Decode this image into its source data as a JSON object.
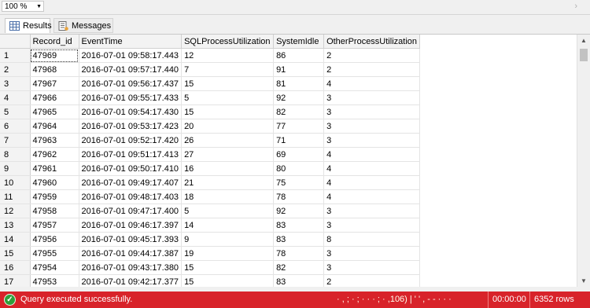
{
  "toolbar": {
    "zoom": "100 %"
  },
  "tabs": [
    {
      "label": "Results",
      "active": true
    },
    {
      "label": "Messages",
      "active": false
    }
  ],
  "grid": {
    "columns": [
      "",
      "Record_id",
      "EventTime",
      "SQLProcessUtilization",
      "SystemIdle",
      "OtherProcessUtilization"
    ],
    "rows": [
      [
        "1",
        "47969",
        "2016-07-01 09:58:17.443",
        "12",
        "86",
        "2"
      ],
      [
        "2",
        "47968",
        "2016-07-01 09:57:17.440",
        "7",
        "91",
        "2"
      ],
      [
        "3",
        "47967",
        "2016-07-01 09:56:17.437",
        "15",
        "81",
        "4"
      ],
      [
        "4",
        "47966",
        "2016-07-01 09:55:17.433",
        "5",
        "92",
        "3"
      ],
      [
        "5",
        "47965",
        "2016-07-01 09:54:17.430",
        "15",
        "82",
        "3"
      ],
      [
        "6",
        "47964",
        "2016-07-01 09:53:17.423",
        "20",
        "77",
        "3"
      ],
      [
        "7",
        "47963",
        "2016-07-01 09:52:17.420",
        "26",
        "71",
        "3"
      ],
      [
        "8",
        "47962",
        "2016-07-01 09:51:17.413",
        "27",
        "69",
        "4"
      ],
      [
        "9",
        "47961",
        "2016-07-01 09:50:17.410",
        "16",
        "80",
        "4"
      ],
      [
        "10",
        "47960",
        "2016-07-01 09:49:17.407",
        "21",
        "75",
        "4"
      ],
      [
        "11",
        "47959",
        "2016-07-01 09:48:17.403",
        "18",
        "78",
        "4"
      ],
      [
        "12",
        "47958",
        "2016-07-01 09:47:17.400",
        "5",
        "92",
        "3"
      ],
      [
        "13",
        "47957",
        "2016-07-01 09:46:17.397",
        "14",
        "83",
        "3"
      ],
      [
        "14",
        "47956",
        "2016-07-01 09:45:17.393",
        "9",
        "83",
        "8"
      ],
      [
        "15",
        "47955",
        "2016-07-01 09:44:17.387",
        "19",
        "78",
        "3"
      ],
      [
        "16",
        "47954",
        "2016-07-01 09:43:17.380",
        "15",
        "82",
        "3"
      ],
      [
        "17",
        "47953",
        "2016-07-01 09:42:17.377",
        "15",
        "83",
        "2"
      ]
    ]
  },
  "status": {
    "message": "Query executed successfully.",
    "server": "· , ; · ; · · · ; · ,106) | ' ' , - - · · ·",
    "elapsed": "00:00:00",
    "rows": "6352 rows"
  },
  "colors": {
    "status_bar": "#d8232a",
    "success": "#2e9e3a"
  }
}
